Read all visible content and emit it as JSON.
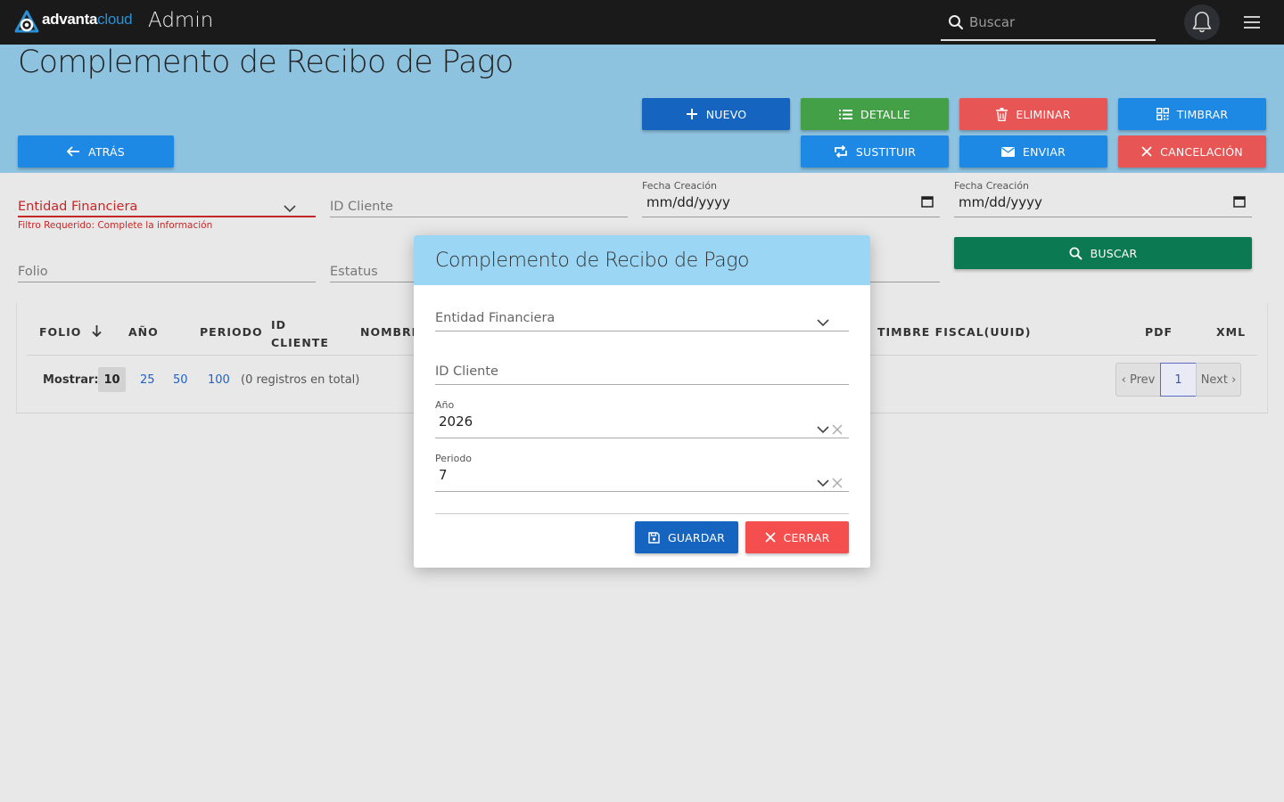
{
  "topbar": {
    "brand_a": "advanta",
    "brand_b": "cloud",
    "section": "Admin",
    "search_placeholder": "Buscar",
    "bg": "#1a1a1a"
  },
  "page": {
    "title": "Complemento de Recibo de Pago",
    "band_color": "#8ec3e0"
  },
  "actions": {
    "nuevo": "NUEVO",
    "detalle": "DETALLE",
    "eliminar": "ELIMINAR",
    "timbrar": "TIMBRAR",
    "atras": "ATRÁS",
    "sustituir": "SUSTITUIR",
    "enviar": "ENVIAR",
    "cancelacion": "CANCELACIÓN",
    "colors": {
      "blue": "#1e88e5",
      "dark_blue": "#1565c0",
      "green": "#43a047",
      "red": "#e85555",
      "dark_green": "#0b7a52"
    }
  },
  "filters": {
    "entidad": "Entidad Financiera",
    "entidad_error": "Filtro Requerido: Complete la información",
    "id_cliente": "ID Cliente",
    "fecha_label_1": "Fecha Creación",
    "fecha_value_1": "mm/dd/yyyy",
    "fecha_label_2": "Fecha Creación",
    "fecha_value_2": "mm/dd/yyyy",
    "folio": "Folio",
    "estatus": "Estatus",
    "buscar": "BUSCAR",
    "error_color": "#c62828"
  },
  "table": {
    "headers": {
      "folio": "FOLIO",
      "anio": "AÑO",
      "periodo": "PERIODO",
      "id": "ID",
      "cliente": "CLIENTE",
      "nombre": "NOMBRE",
      "timbre": "TIMBRE FISCAL(UUID)",
      "pdf": "PDF",
      "xml": "XML"
    },
    "mostrar_label": "Mostrar:",
    "page_sizes": [
      "10",
      "25",
      "50",
      "100"
    ],
    "selected_size": "10",
    "total_text": "(0 registros en total)",
    "prev": "‹ Prev",
    "current_page": "1",
    "next": "Next ›"
  },
  "modal": {
    "title": "Complemento de Recibo de Pago",
    "entidad": "Entidad Financiera",
    "id_cliente": "ID Cliente",
    "anio_label": "Año",
    "anio_value": "2026",
    "periodo_label": "Periodo",
    "periodo_value": "7",
    "guardar": "GUARDAR",
    "cerrar": "CERRAR",
    "header_color": "#9bd6f4"
  }
}
